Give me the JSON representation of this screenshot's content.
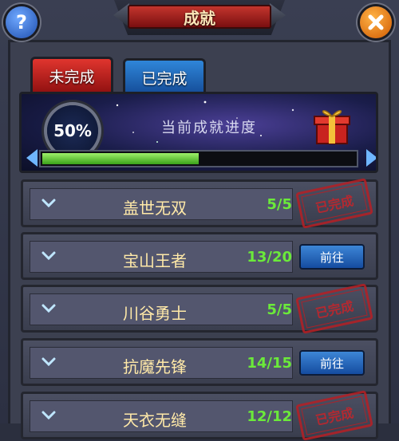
{
  "title": "成就",
  "tabs": [
    {
      "label": "未完成",
      "active": false
    },
    {
      "label": "已完成",
      "active": true
    }
  ],
  "progress": {
    "percent_label": "50%",
    "percent_value": 0.5,
    "label": "当前成就进度",
    "bar_fill_fraction": 0.5
  },
  "achievements": [
    {
      "name": "盖世无双",
      "progress": "5/5",
      "status": "completed",
      "stamp": "已完成"
    },
    {
      "name": "宝山王者",
      "progress": "13/20",
      "status": "in_progress",
      "button": "前往"
    },
    {
      "name": "川谷勇士",
      "progress": "5/5",
      "status": "completed",
      "stamp": "已完成"
    },
    {
      "name": "抗魔先锋",
      "progress": "14/15",
      "status": "in_progress",
      "button": "前往"
    },
    {
      "name": "天衣无缝",
      "progress": "12/12",
      "status": "completed",
      "stamp": "已完成"
    }
  ],
  "icons": {
    "help": "question-icon",
    "close": "close-icon",
    "gift": "gift-box-icon",
    "expand": "chevron-down-icon"
  },
  "colors": {
    "progress_text": "#6bea3a",
    "name_text": "#ffe9a8",
    "stamp": "#c7242a"
  }
}
